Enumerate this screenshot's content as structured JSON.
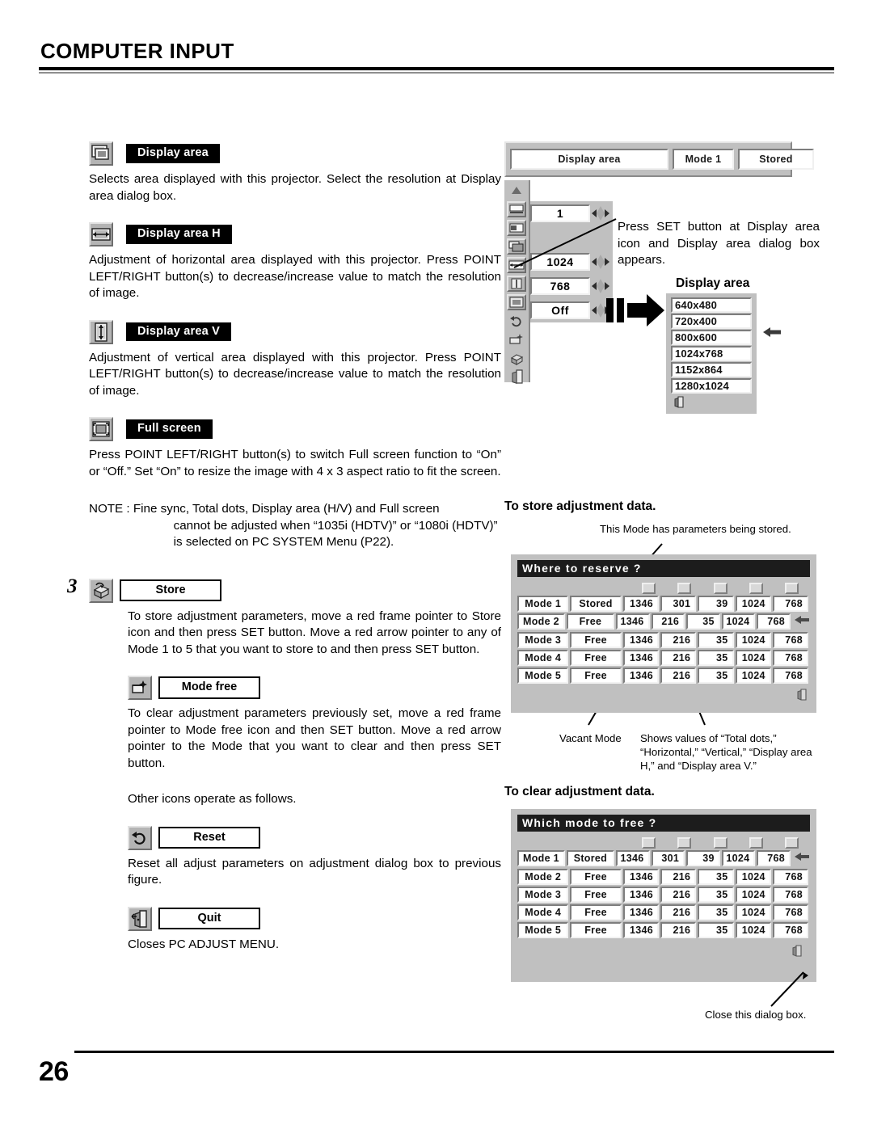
{
  "header": {
    "title": "COMPUTER INPUT"
  },
  "footer": {
    "page_number": "26"
  },
  "left_column": {
    "items": [
      {
        "icon": "display-area-icon",
        "label": "Display area",
        "label_style": "dark",
        "body": "Selects area displayed with this projector.  Select the resolution at Display area dialog box."
      },
      {
        "icon": "display-area-h-icon",
        "label": "Display area H",
        "label_style": "dark",
        "body": "Adjustment of horizontal area displayed with this projector.  Press POINT LEFT/RIGHT button(s) to decrease/increase value to match the resolution of image."
      },
      {
        "icon": "display-area-v-icon",
        "label": "Display area V",
        "label_style": "dark",
        "body": "Adjustment of vertical area displayed with this projector.  Press POINT LEFT/RIGHT button(s) to decrease/increase value to match the resolution of image."
      },
      {
        "icon": "full-screen-icon",
        "label": "Full screen",
        "label_style": "dark",
        "body": "Press POINT LEFT/RIGHT button(s) to switch Full screen function to “On” or “Off.”  Set “On” to resize the image with 4 x 3 aspect ratio to fit the screen."
      }
    ],
    "note": {
      "label": "NOTE :",
      "line1": "Fine sync, Total dots, Display area (H/V) and Full screen",
      "line2": "cannot be adjusted when “1035i (HDTV)” or “1080i (HDTV)”",
      "line3": "is selected on PC SYSTEM Menu (P22)."
    },
    "step3": {
      "number": "3",
      "items": [
        {
          "icon": "store-icon",
          "label": "Store",
          "label_style": "light",
          "body": "To store adjustment parameters, move a red frame pointer to Store icon and then press SET button.  Move a red arrow pointer to any of Mode 1 to 5 that you want to store to and then press SET button."
        },
        {
          "icon": "mode-free-icon",
          "label": "Mode free",
          "label_style": "light",
          "body": "To clear adjustment parameters previously set, move a red frame pointer to Mode free icon and then SET button.  Move a red arrow pointer to the Mode that you want to clear and then press SET button."
        }
      ],
      "other_icons_text": "Other icons operate as follows.",
      "other_items": [
        {
          "icon": "reset-icon",
          "label": "Reset",
          "label_style": "light",
          "body": "Reset all adjust parameters on adjustment dialog box to previous figure."
        },
        {
          "icon": "quit-icon",
          "label": "Quit",
          "label_style": "light",
          "body": "Closes PC ADJUST MENU."
        }
      ]
    }
  },
  "right_column": {
    "osd_menubar": {
      "display_area": "Display area",
      "mode": "Mode 1",
      "stored": "Stored"
    },
    "osd_values": [
      {
        "name": "fine-sync-value",
        "value": "1"
      },
      {
        "name": "display-area-h-value",
        "value": "1024"
      },
      {
        "name": "display-area-v-value",
        "value": "768"
      },
      {
        "name": "full-screen-value",
        "value": "Off"
      }
    ],
    "callout_text": "Press SET button at Display area icon and Display area dialog box appears.",
    "display_area_dialog": {
      "heading": "Display area",
      "options": [
        "640x480",
        "720x400",
        "800x600",
        "1024x768",
        "1152x864",
        "1280x1024"
      ],
      "selected": "800x600"
    },
    "store_section": {
      "heading": "To store adjustment data.",
      "callout_top": "This Mode has parameters being stored.",
      "callout_left": "Vacant Mode",
      "callout_right": "Shows values of “Total dots,” “Horizontal,” “Vertical,” “Display area H,” and “Display area V.”",
      "dialog": {
        "title": "Where to reserve ?",
        "column_icons": [
          "total-dots-icon",
          "horizontal-icon",
          "vertical-icon",
          "display-area-h-icon",
          "display-area-v-icon"
        ],
        "rows": [
          {
            "mode": "Mode 1",
            "status": "Stored",
            "total_dots": "1346",
            "horizontal": "301",
            "vertical": "39",
            "display_h": "1024",
            "display_v": "768"
          },
          {
            "mode": "Mode 2",
            "status": "Free",
            "total_dots": "1346",
            "horizontal": "216",
            "vertical": "35",
            "display_h": "1024",
            "display_v": "768"
          },
          {
            "mode": "Mode 3",
            "status": "Free",
            "total_dots": "1346",
            "horizontal": "216",
            "vertical": "35",
            "display_h": "1024",
            "display_v": "768"
          },
          {
            "mode": "Mode 4",
            "status": "Free",
            "total_dots": "1346",
            "horizontal": "216",
            "vertical": "35",
            "display_h": "1024",
            "display_v": "768"
          },
          {
            "mode": "Mode 5",
            "status": "Free",
            "total_dots": "1346",
            "horizontal": "216",
            "vertical": "35",
            "display_h": "1024",
            "display_v": "768"
          }
        ],
        "pointer_row_index": 1
      }
    },
    "clear_section": {
      "heading": "To clear adjustment data.",
      "callout_bottom": "Close this dialog box.",
      "dialog": {
        "title": "Which mode to free ?",
        "column_icons": [
          "total-dots-icon",
          "horizontal-icon",
          "vertical-icon",
          "display-area-h-icon",
          "display-area-v-icon"
        ],
        "rows": [
          {
            "mode": "Mode 1",
            "status": "Stored",
            "total_dots": "1346",
            "horizontal": "301",
            "vertical": "39",
            "display_h": "1024",
            "display_v": "768"
          },
          {
            "mode": "Mode 2",
            "status": "Free",
            "total_dots": "1346",
            "horizontal": "216",
            "vertical": "35",
            "display_h": "1024",
            "display_v": "768"
          },
          {
            "mode": "Mode 3",
            "status": "Free",
            "total_dots": "1346",
            "horizontal": "216",
            "vertical": "35",
            "display_h": "1024",
            "display_v": "768"
          },
          {
            "mode": "Mode 4",
            "status": "Free",
            "total_dots": "1346",
            "horizontal": "216",
            "vertical": "35",
            "display_h": "1024",
            "display_v": "768"
          },
          {
            "mode": "Mode 5",
            "status": "Free",
            "total_dots": "1346",
            "horizontal": "216",
            "vertical": "35",
            "display_h": "1024",
            "display_v": "768"
          }
        ],
        "pointer_row_index": 0
      }
    }
  },
  "colors": {
    "osd_gray": "#c0c0c0",
    "icon_gray": "#b4b4b4",
    "titlebar": "#1c1c1c",
    "text": "#000000"
  }
}
